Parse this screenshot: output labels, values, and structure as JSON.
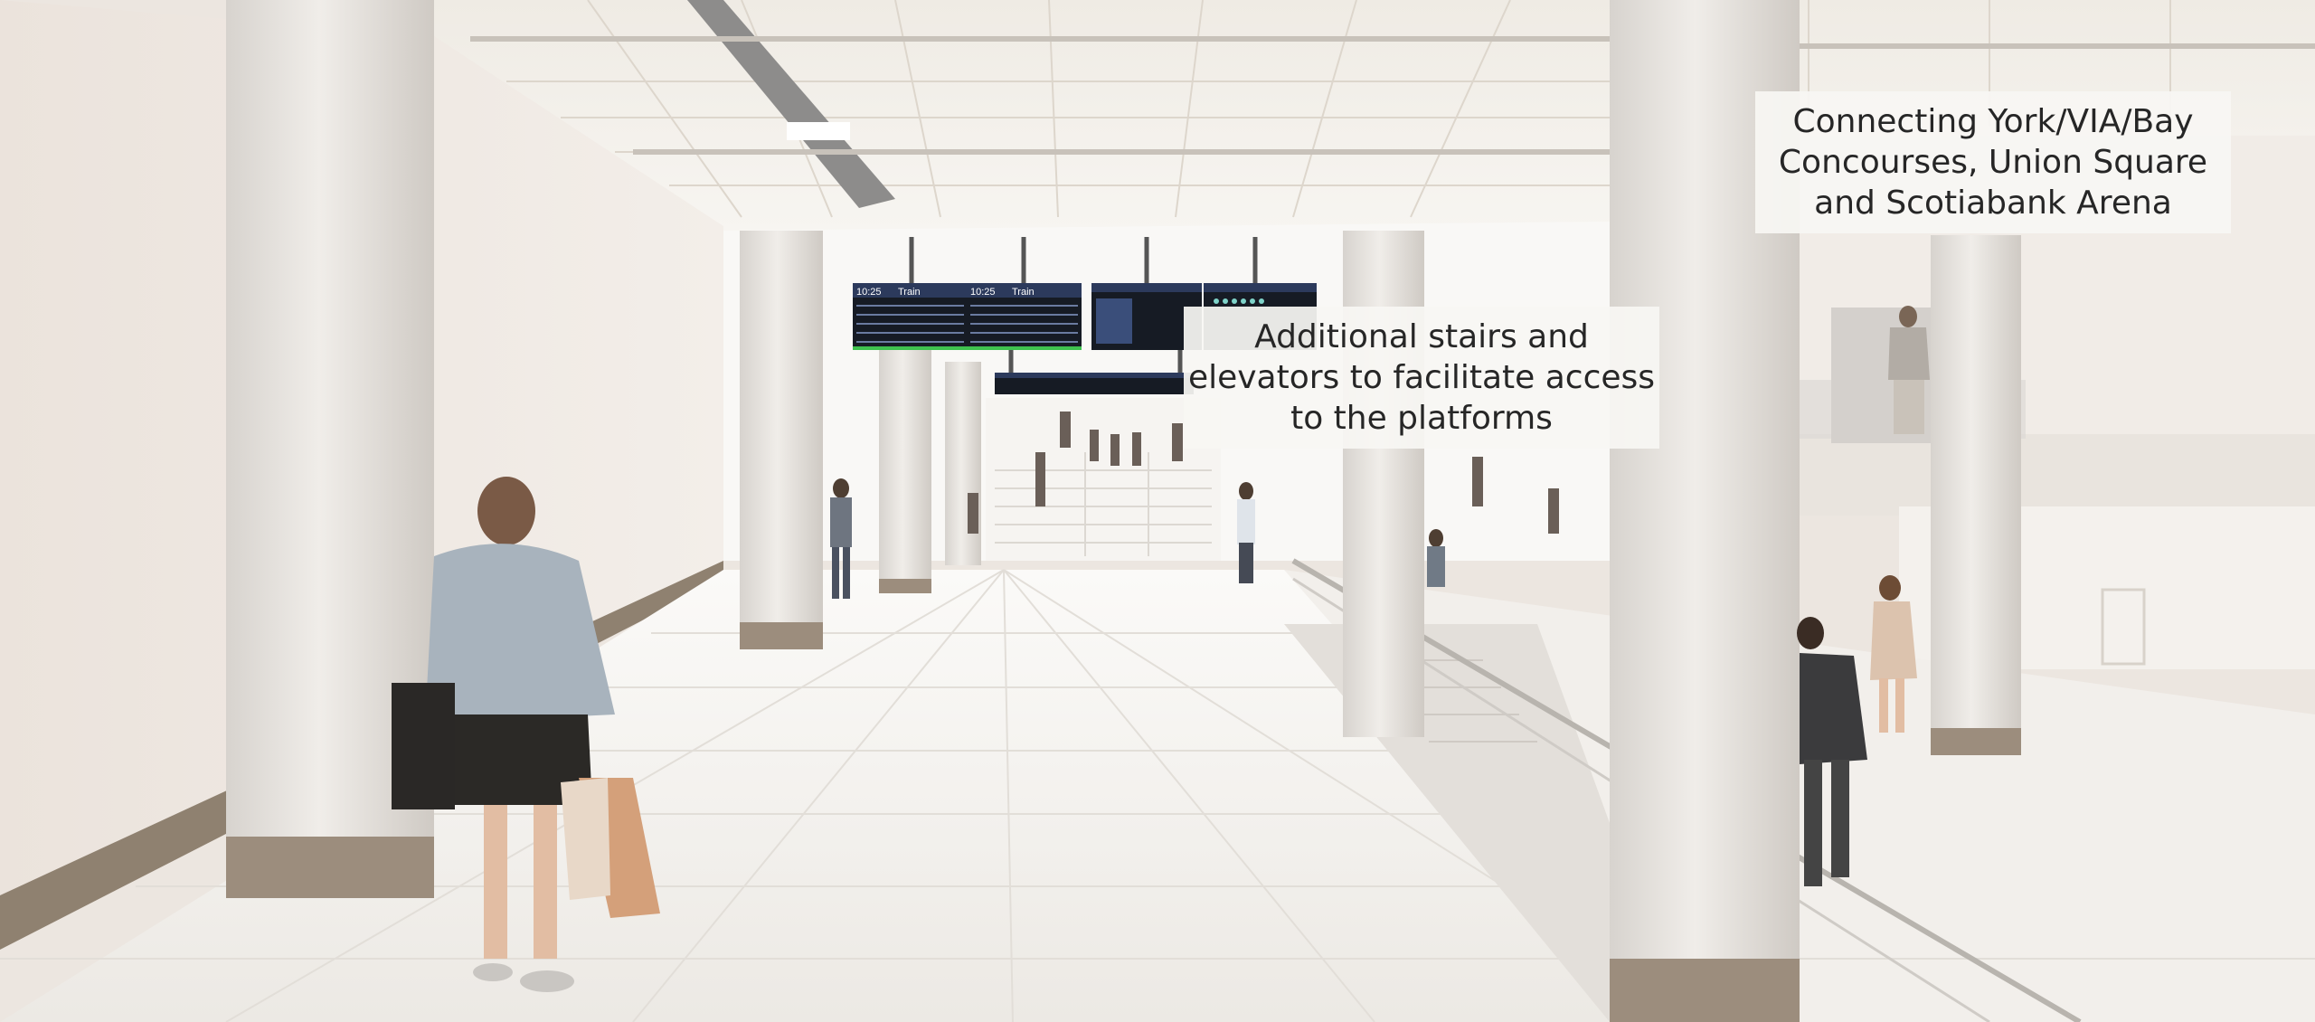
{
  "image_title": "",
  "callouts": {
    "concourses": {
      "line1": "Connecting York/VIA/Bay",
      "line2": "Concourses, Union Square",
      "line3": "and Scotiabank Arena"
    },
    "stairs": {
      "line1": "Additional stairs and",
      "line2": "elevators to facilitate access",
      "line3": "to the platforms"
    }
  },
  "departure_boards": {
    "board1": {
      "time": "10:25",
      "heading": "Train"
    },
    "board2": {
      "time": "10:25",
      "heading": "Train"
    }
  },
  "colors": {
    "wall": "#ece6e0",
    "floor": "#f1eeea",
    "column": "#e6e2dd",
    "column_base": "#9c8d7d",
    "baseboard": "#8f8170",
    "ceiling": "#f3f0ea",
    "board_header": "#2c3a5c",
    "board_screen": "#161b24",
    "callout_bg": "#f8f6f3"
  }
}
